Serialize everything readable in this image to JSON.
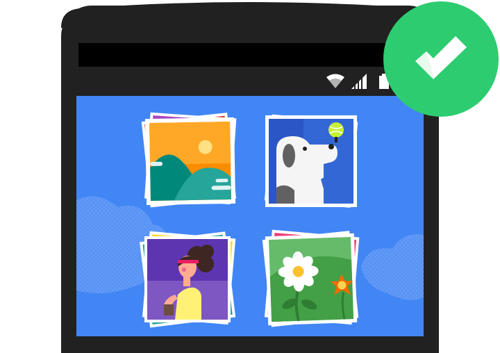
{
  "colors": {
    "phone_body": "#212121",
    "screen_background": "#4285f4",
    "badge_background": "#2ecc71",
    "checkmark": "#ffffff"
  },
  "icons": {
    "status": [
      "wifi-icon",
      "cellular-signal-icon",
      "battery-icon"
    ],
    "badge": "checkmark-icon"
  },
  "photo_stacks": [
    {
      "name": "photo-stack-landscape",
      "subject": "landscape"
    },
    {
      "name": "photo-stack-dog",
      "subject": "dog"
    },
    {
      "name": "photo-stack-portrait",
      "subject": "portrait"
    },
    {
      "name": "photo-stack-flowers",
      "subject": "flowers"
    }
  ]
}
